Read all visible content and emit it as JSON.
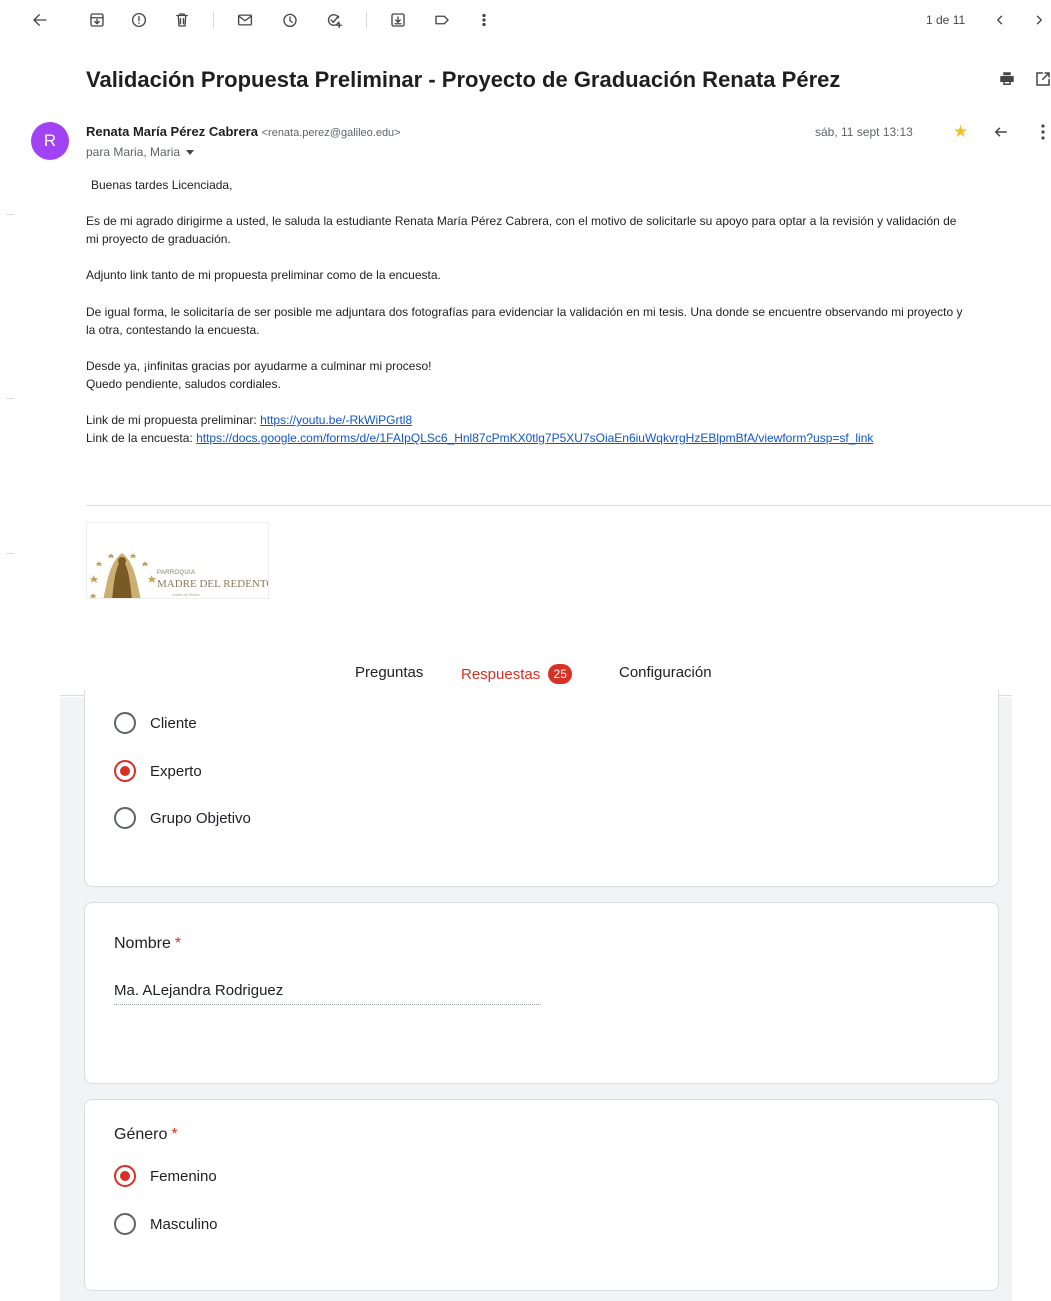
{
  "toolbar": {
    "icons": [
      "back-arrow-icon",
      "archive-icon",
      "report-spam-icon",
      "delete-icon",
      "mark-unread-icon",
      "snooze-icon",
      "add-to-tasks-icon",
      "move-to-icon",
      "label-icon",
      "more-vert-icon"
    ],
    "pager": "1 de 11"
  },
  "email": {
    "subject": "Validación Propuesta Preliminar - Proyecto de Graduación Renata Pérez",
    "avatar_letter": "R",
    "avatar_color": "#a142f4",
    "sender_name": "Renata María Pérez Cabrera",
    "sender_email": "<renata.perez@galileo.edu>",
    "recipients": "para Maria, Maria",
    "date": "sáb, 11 sept 13:13",
    "body": {
      "greeting": "Buenas tardes Licenciada,",
      "p1_line1": "Es de mi agrado dirigirme a usted, le saluda la estudiante Renata María Pérez Cabrera, con el motivo de solicitarle su apoyo para optar a la revisión y validación de",
      "p1_line2": "mi proyecto de graduación.",
      "p2": "Adjunto link tanto de mi propuesta preliminar como de la encuesta.",
      "p3_line1": "De igual forma, le solicitaría de ser posible me adjuntara dos fotografías para evidenciar la validación en mi tesis. Una donde se encuentre observando mi proyecto y",
      "p3_line2": "la otra, contestando la encuesta.",
      "p4_line1": "Desde ya, ¡infinitas gracias por ayudarme a culminar mi proceso!",
      "p4_line2": "Quedo pendiente, saludos cordiales.",
      "link1_label": "Link de mi propuesta preliminar: ",
      "link1_url": "https://youtu.be/-RkWiPGrtl8",
      "link2_label": "Link de la encuesta: ",
      "link2_url": "https://docs.google.com/forms/d/e/1FAIpQLSc6_Hnl87cPmKX0tlg7P5XU7sOiaEn6iuWqkvrgHzEBlpmBfA/viewform?usp=sf_link"
    },
    "signature_logo": {
      "line1": "PARROQUIA",
      "line2": "MADRE DEL REDENTOR",
      "line3": "Santa de María"
    }
  },
  "form": {
    "tabs": [
      {
        "label": "Preguntas"
      },
      {
        "label": "Respuestas",
        "count": "25"
      },
      {
        "label": "Configuración"
      }
    ],
    "accent_color": "#d93025",
    "q1": {
      "options": [
        {
          "label": "Cliente",
          "checked": false
        },
        {
          "label": "Experto",
          "checked": true
        },
        {
          "label": "Grupo Objetivo",
          "checked": false
        }
      ]
    },
    "q2": {
      "title": "Nombre",
      "required_mark": "*",
      "answer": "Ma. ALejandra Rodriguez"
    },
    "q3": {
      "title": "Género",
      "required_mark": "*",
      "options": [
        {
          "label": "Femenino",
          "checked": true
        },
        {
          "label": "Masculino",
          "checked": false
        }
      ]
    }
  }
}
